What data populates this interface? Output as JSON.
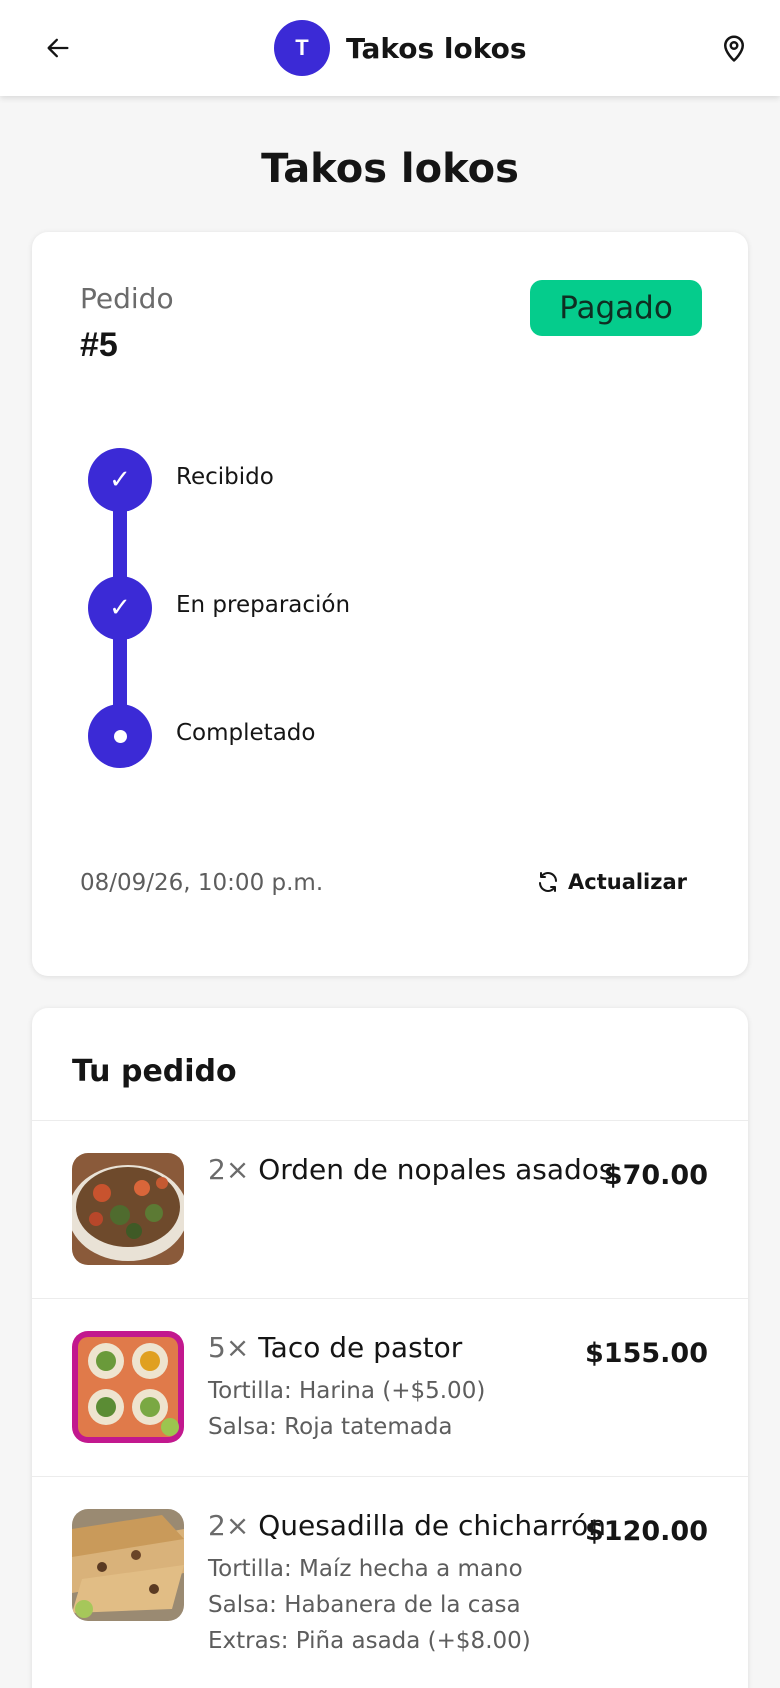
{
  "header": {
    "avatar_letter": "T",
    "restaurant_name": "Takos lokos"
  },
  "page_title": "Takos lokos",
  "order": {
    "label": "Pedido",
    "number": "#5",
    "payment_status": "Pagado",
    "datetime": "08/09/26, 10:00 p.m.",
    "refresh_label": "Actualizar"
  },
  "timeline": [
    {
      "label": "Recibido",
      "state": "done",
      "icon": "✓"
    },
    {
      "label": "En preparación",
      "state": "done",
      "icon": "✓"
    },
    {
      "label": "Completado",
      "state": "current",
      "icon": "dot"
    }
  ],
  "items_section": {
    "title": "Tu pedido",
    "items": [
      {
        "qty": "2×",
        "name": "Orden de nopales asados",
        "price": "$70.00",
        "options": []
      },
      {
        "qty": "5×",
        "name": "Taco de pastor",
        "price": "$155.00",
        "options": [
          {
            "key": "Tortilla:",
            "value": "Harina (+$5.00)"
          },
          {
            "key": "Salsa:",
            "value": "Roja tatemada"
          }
        ]
      },
      {
        "qty": "2×",
        "name": "Quesadilla de chicharrón",
        "price": "$120.00",
        "options": [
          {
            "key": "Tortilla:",
            "value": "Maíz hecha a mano"
          },
          {
            "key": "Salsa:",
            "value": "Habanera de la casa"
          },
          {
            "key": "Extras:",
            "value": "Piña asada (+$8.00)"
          }
        ]
      }
    ]
  },
  "colors": {
    "brand": "#3b2ad6",
    "paid_badge": "#05cc8c",
    "background": "#f6f6f6"
  },
  "icons": [
    "arrow-left-icon",
    "map-pin-icon",
    "check-icon",
    "refresh-icon"
  ]
}
